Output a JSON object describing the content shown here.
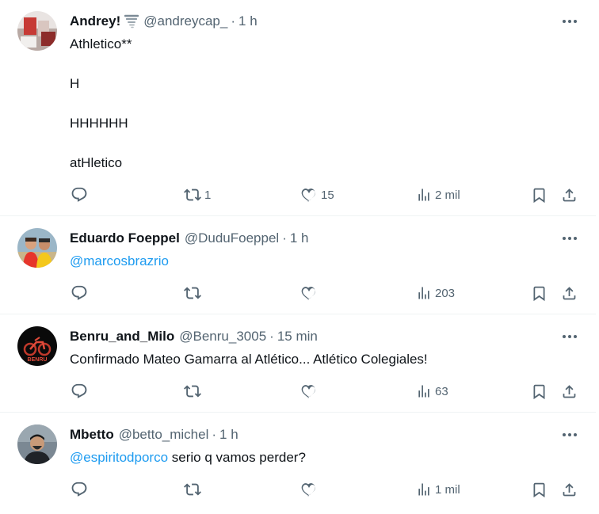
{
  "tweets": [
    {
      "name": "Andrey!",
      "handle": "@andreycap_",
      "separator": "·",
      "time": "1 h",
      "lines": [
        "Athletico**",
        "H",
        "HHHHHH",
        "atHletico"
      ],
      "stats": {
        "replies": "",
        "retweets": "1",
        "likes": "15",
        "views": "2 mil"
      },
      "badge_icon": "tornado-icon"
    },
    {
      "name": "Eduardo Foeppel",
      "handle": "@DuduFoeppel",
      "separator": "·",
      "time": "1 h",
      "mention": "@marcosbrazrio",
      "stats": {
        "replies": "",
        "retweets": "",
        "likes": "",
        "views": "203"
      }
    },
    {
      "name": "Benru_and_Milo",
      "handle": "@Benru_3005",
      "separator": "·",
      "time": "15 min",
      "text": "Confirmado Mateo Gamarra al Atlético... Atlético Colegiales!",
      "stats": {
        "replies": "",
        "retweets": "",
        "likes": "",
        "views": "63"
      },
      "avatar_text": "BENRU"
    },
    {
      "name": "Mbetto",
      "handle": "@betto_michel",
      "separator": "·",
      "time": "1 h",
      "mention": "@espiritodporco",
      "text": " serio q vamos perder?",
      "stats": {
        "replies": "",
        "retweets": "",
        "likes": "",
        "views": "1 mil"
      }
    }
  ],
  "colors": {
    "text": "#0f1419",
    "secondary": "#536471",
    "link": "#1d9bf0",
    "divider": "#eff3f4"
  }
}
